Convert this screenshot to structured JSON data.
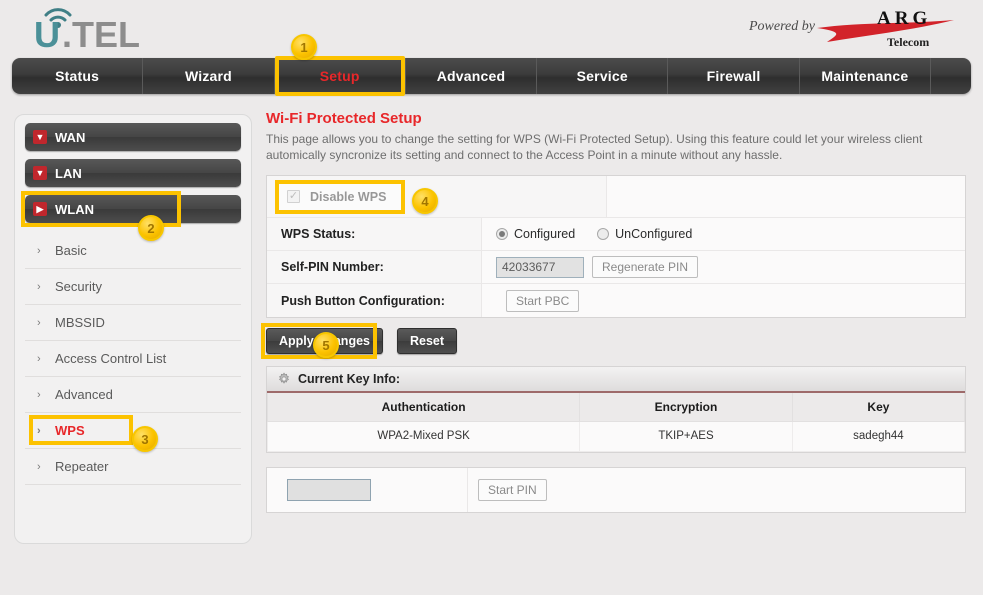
{
  "header": {
    "logo_text": "U.TEL",
    "logo_icon": "wifi-signal-icon",
    "powered_by": "Powered by",
    "brand_name": "ARG",
    "brand_sub": "Telecom"
  },
  "nav": {
    "items": [
      {
        "label": "Status",
        "active": false
      },
      {
        "label": "Wizard",
        "active": false
      },
      {
        "label": "Setup",
        "active": true
      },
      {
        "label": "Advanced",
        "active": false
      },
      {
        "label": "Service",
        "active": false
      },
      {
        "label": "Firewall",
        "active": false
      },
      {
        "label": "Maintenance",
        "active": false
      }
    ]
  },
  "markers": {
    "m1": "1",
    "m2": "2",
    "m3": "3",
    "m4": "4",
    "m5": "5"
  },
  "sidebar": {
    "groups": [
      {
        "label": "WAN",
        "icon": "chevron-down-icon",
        "glyph": "▼",
        "highlighted": false
      },
      {
        "label": "LAN",
        "icon": "chevron-down-icon",
        "glyph": "▼",
        "highlighted": false
      },
      {
        "label": "WLAN",
        "icon": "chevron-right-icon",
        "glyph": "▶",
        "highlighted": true
      }
    ],
    "items": [
      {
        "label": "Basic",
        "selected": false
      },
      {
        "label": "Security",
        "selected": false
      },
      {
        "label": "MBSSID",
        "selected": false
      },
      {
        "label": "Access Control List",
        "selected": false
      },
      {
        "label": "Advanced",
        "selected": false
      },
      {
        "label": "WPS",
        "selected": true
      },
      {
        "label": "Repeater",
        "selected": false
      }
    ]
  },
  "main": {
    "title": "Wi-Fi Protected Setup",
    "description": "This page allows you to change the setting for WPS (Wi-Fi Protected Setup). Using this feature could let your wireless client automically syncronize its setting and connect to the Access Point in a minute without any hassle.",
    "disable_wps": {
      "label": "Disable WPS",
      "checked": true,
      "check_glyph": "✓"
    },
    "wps_status": {
      "label": "WPS Status:",
      "options": [
        {
          "label": "Configured",
          "selected": true
        },
        {
          "label": "UnConfigured",
          "selected": false
        }
      ]
    },
    "self_pin": {
      "label": "Self-PIN Number:",
      "value": "42033677",
      "button": "Regenerate PIN"
    },
    "pbc": {
      "label": "Push Button Configuration:",
      "button": "Start PBC"
    },
    "buttons": {
      "apply": "Apply Changes",
      "reset": "Reset"
    },
    "key_info": {
      "title": "Current Key Info:",
      "icon": "gear-icon",
      "columns": [
        "Authentication",
        "Encryption",
        "Key"
      ],
      "rows": [
        [
          "WPA2-Mixed PSK",
          "TKIP+AES",
          "sadegh44"
        ]
      ]
    },
    "client_pin": {
      "value": "",
      "placeholder": "",
      "button": "Start PIN"
    }
  },
  "colors": {
    "accent_red": "#e8272a",
    "highlight_yellow": "#fcc200",
    "nav_dark": "#3b3b3b",
    "brand_red": "#d2232a"
  }
}
